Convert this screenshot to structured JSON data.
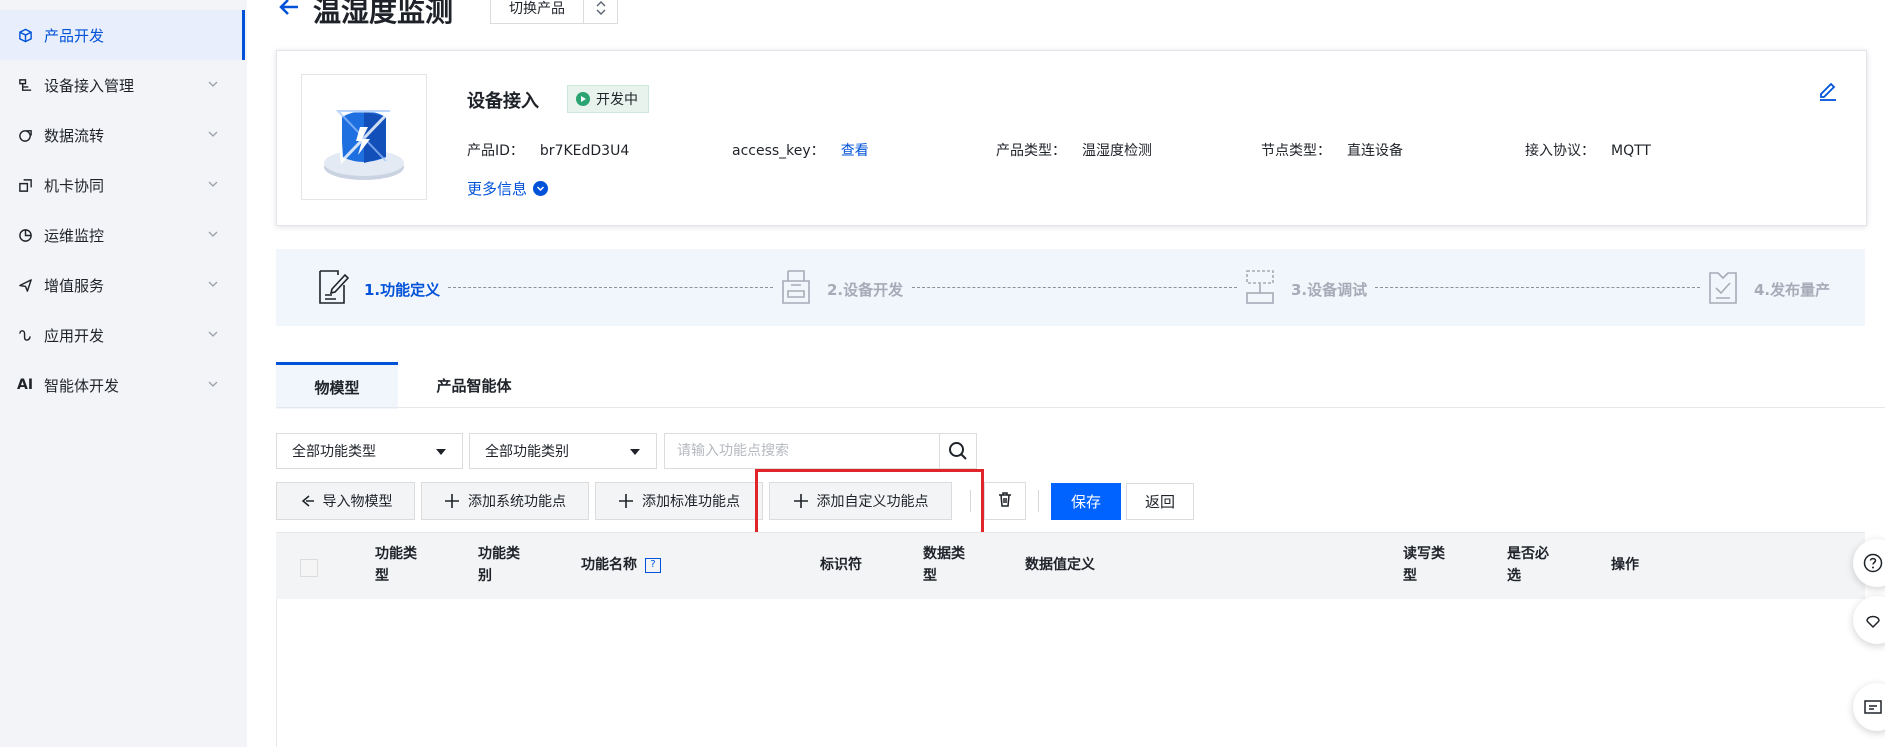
{
  "sidebar": {
    "items": [
      {
        "label": "产品开发",
        "icon": "cube-icon",
        "active": true
      },
      {
        "label": "设备接入管理",
        "icon": "device-access-icon"
      },
      {
        "label": "数据流转",
        "icon": "data-flow-icon"
      },
      {
        "label": "机卡协同",
        "icon": "card-link-icon"
      },
      {
        "label": "运维监控",
        "icon": "pie-chart-icon"
      },
      {
        "label": "增值服务",
        "icon": "send-icon"
      },
      {
        "label": "应用开发",
        "icon": "app-dev-icon"
      },
      {
        "label": "智能体开发",
        "icon": "ai-icon",
        "icon_text": "AI"
      }
    ]
  },
  "header": {
    "title": "温湿度监测",
    "switch_label": "切换产品"
  },
  "product": {
    "name": "设备接入",
    "status": "开发中",
    "fields": [
      {
        "key": "产品ID：",
        "value": "br7KEdD3U4"
      },
      {
        "key": "access_key：",
        "value": "查看",
        "is_link": true
      },
      {
        "key": "产品类型：",
        "value": "温湿度检测"
      },
      {
        "key": "节点类型：",
        "value": "直连设备"
      },
      {
        "key": "接入协议：",
        "value": "MQTT"
      }
    ],
    "more_info": "更多信息"
  },
  "steps": [
    {
      "label": "1.功能定义",
      "icon": "document-edit-icon",
      "active": true
    },
    {
      "label": "2.设备开发",
      "icon": "printer-icon"
    },
    {
      "label": "3.设备调试",
      "icon": "debug-icon"
    },
    {
      "label": "4.发布量产",
      "icon": "clipboard-check-icon"
    }
  ],
  "tabs": [
    {
      "label": "物模型",
      "active": true
    },
    {
      "label": "产品智能体"
    }
  ],
  "filters": {
    "type_select": "全部功能类型",
    "category_select": "全部功能类别",
    "search_placeholder": "请输入功能点搜索"
  },
  "toolbar": {
    "import_label": "导入物模型",
    "add_system_label": "添加系统功能点",
    "add_standard_label": "添加标准功能点",
    "add_custom_label": "添加自定义功能点",
    "save_label": "保存",
    "back_label": "返回",
    "highlight_color": "#e0242a"
  },
  "table": {
    "columns": [
      {
        "line1": "功能类",
        "line2": "型"
      },
      {
        "line1": "功能类",
        "line2": "别"
      },
      {
        "line1": "功能名称",
        "line2": ""
      },
      {
        "line1": "标识符",
        "line2": ""
      },
      {
        "line1": "数据类",
        "line2": "型"
      },
      {
        "line1": "数据值定义",
        "line2": ""
      },
      {
        "line1": "读写类",
        "line2": "型"
      },
      {
        "line1": "是否必",
        "line2": "选"
      },
      {
        "line1": "操作",
        "line2": ""
      }
    ],
    "help_icon_text": "?"
  },
  "colors": {
    "primary": "#0052d9",
    "button_primary": "#0062ff",
    "status_green": "#2ba471"
  }
}
